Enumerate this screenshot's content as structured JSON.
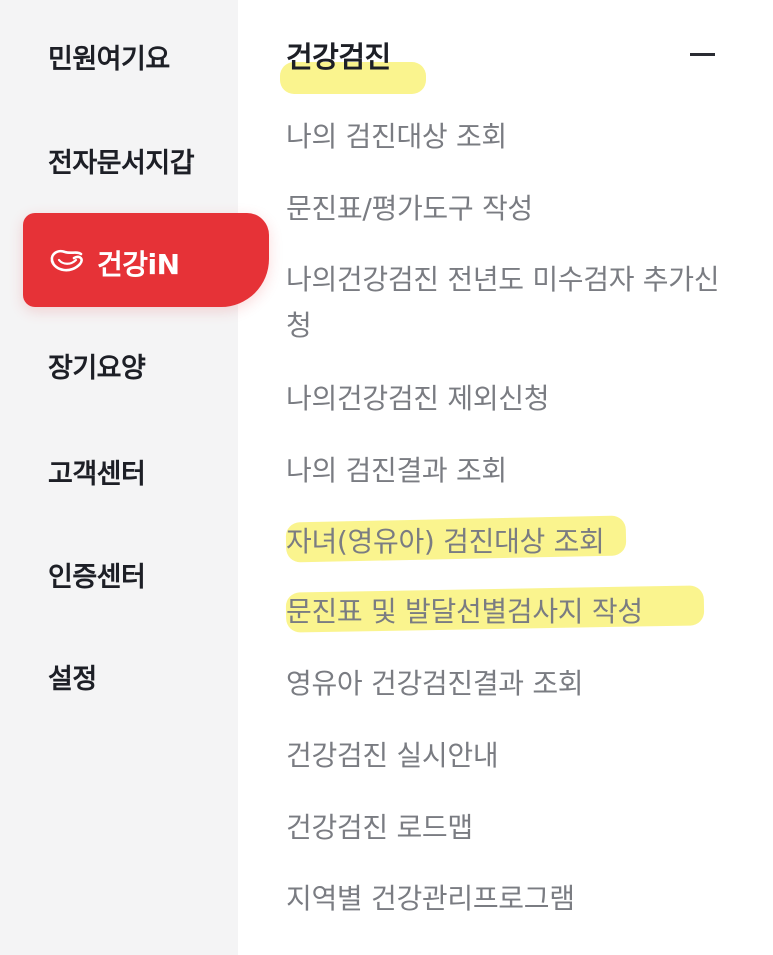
{
  "sidebar": {
    "items": [
      {
        "label": "민원여기요"
      },
      {
        "label": "전자문서지갑"
      },
      {
        "label": "건강iN",
        "active": true,
        "icon": "health-logo-icon"
      },
      {
        "label": "장기요양"
      },
      {
        "label": "고객센터"
      },
      {
        "label": "인증센터"
      },
      {
        "label": "설정"
      }
    ]
  },
  "section": {
    "title": "건강검진",
    "collapse_icon": "minus-icon",
    "items": [
      {
        "label": "나의 검진대상 조회"
      },
      {
        "label": "문진표/평가도구 작성"
      },
      {
        "label": "나의건강검진 전년도 미수검자 추가신청"
      },
      {
        "label": "나의건강검진 제외신청"
      },
      {
        "label": "나의 검진결과 조회"
      },
      {
        "label": "자녀(영유아) 검진대상 조회"
      },
      {
        "label": "문진표 및 발달선별검사지 작성"
      },
      {
        "label": "영유아 건강검진결과 조회"
      },
      {
        "label": "건강검진 실시안내"
      },
      {
        "label": "건강검진 로드맵"
      },
      {
        "label": "지역별 건강관리프로그램"
      }
    ]
  },
  "colors": {
    "accent": "#e63237",
    "highlight": "#f9f27a",
    "sidebar_bg": "#f4f4f5",
    "text_dark": "#1d1f26",
    "text_muted": "#7a7c82"
  }
}
